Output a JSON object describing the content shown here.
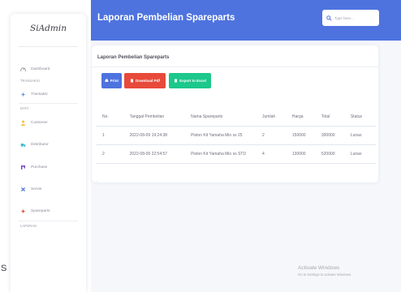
{
  "page_title": "Laporan Pembelian Spareparts",
  "search": {
    "placeholder": "Type here..."
  },
  "brand": "SiAdmin",
  "sidebar": {
    "items": [
      {
        "label": "Dashboard",
        "icon": "dashboard-icon"
      },
      {
        "label": "Transaksi",
        "icon": "plus-icon"
      },
      {
        "label": "Customer",
        "icon": "user-icon"
      },
      {
        "label": "Distributor",
        "icon": "truck-icon"
      },
      {
        "label": "Purchase",
        "icon": "cart-icon"
      },
      {
        "label": "Servis",
        "icon": "wrench-icon"
      },
      {
        "label": "Spareparts",
        "icon": "sparepart-icon"
      }
    ],
    "headings": [
      "TRANSAKSI",
      "DATA",
      "LAPORAN"
    ]
  },
  "card": {
    "title": "Laporan Pembelian Spareparts",
    "buttons": {
      "print": "Print",
      "pdf": "Download Pdf",
      "excel": "Export to Excel"
    }
  },
  "table": {
    "headers": [
      "No.",
      "Tanggal Pembelian",
      "Nama Spareparts",
      "Jumlah",
      "Harga",
      "Total",
      "Status"
    ],
    "rows": [
      [
        "1",
        "2022-08-09 19:24:38",
        "Piston Kit Yamaha Mio ss 25",
        "2",
        "150000",
        "300000",
        "Lunas"
      ],
      [
        "2",
        "2022-08-09 22:54:57",
        "Piston Kit Yamaha Mio ss STD",
        "4",
        "130000",
        "520000",
        "Lunas"
      ]
    ]
  },
  "watermark": {
    "line1": "Activate Windows",
    "line2": "Go to Settings to activate Windows."
  },
  "stray_letter": "S",
  "colors": {
    "primary": "#4e73df",
    "danger": "#e74a3b",
    "success": "#1cc88a"
  }
}
